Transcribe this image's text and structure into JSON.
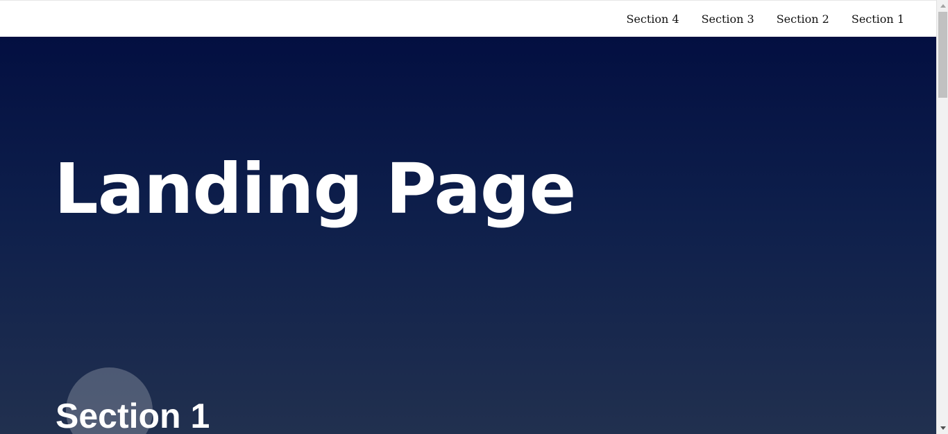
{
  "nav": {
    "items": [
      {
        "label": "Section 4"
      },
      {
        "label": "Section 3"
      },
      {
        "label": "Section 2"
      },
      {
        "label": "Section 1"
      }
    ]
  },
  "hero": {
    "title": "Landing Page"
  },
  "section1": {
    "heading": "Section 1"
  },
  "colors": {
    "navbar_bg": "#ffffff",
    "hero_gradient_top": "#030f41",
    "hero_gradient_bottom": "#21304f",
    "text_light": "#ffffff"
  },
  "icons": {
    "scroll_up": "scroll-up-arrow-icon",
    "scroll_down": "scroll-down-arrow-icon"
  }
}
